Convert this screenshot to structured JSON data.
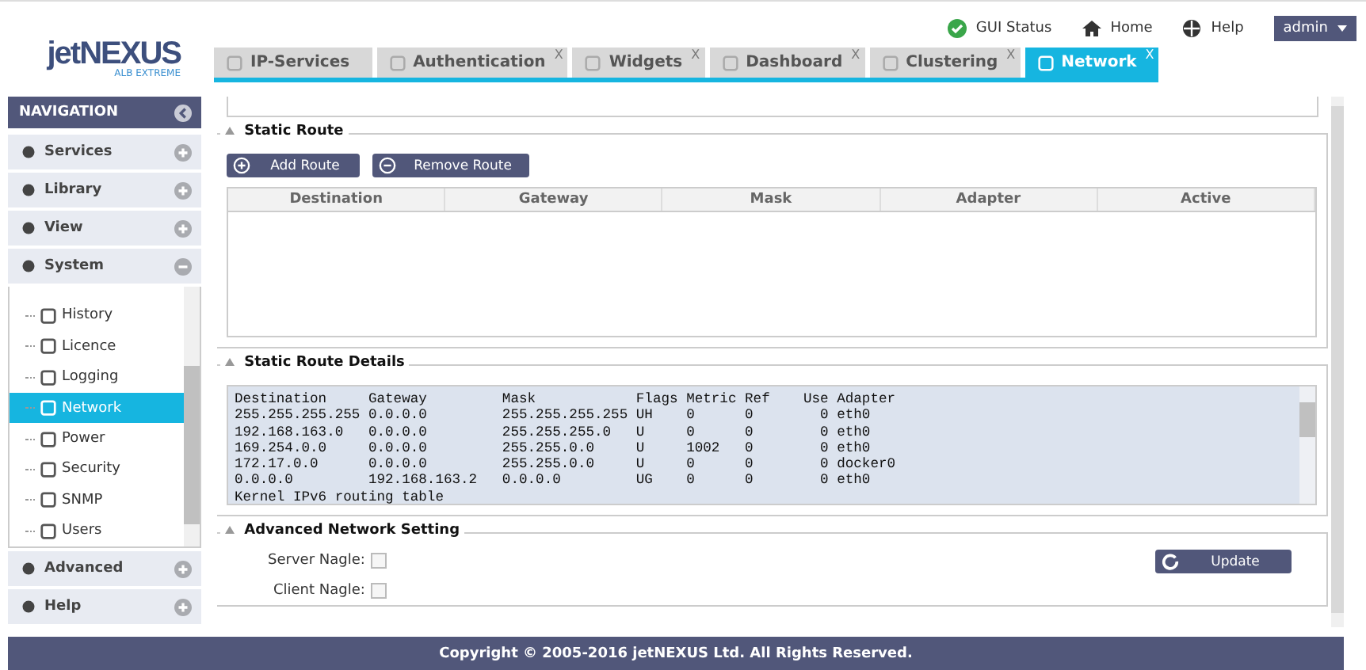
{
  "header": {
    "logo": {
      "name": "jetNEXUS",
      "tagline": "ALB EXTREME"
    },
    "links": [
      {
        "label": "GUI Status"
      },
      {
        "label": "Home"
      },
      {
        "label": "Help"
      }
    ],
    "user_menu": "admin"
  },
  "tabs": [
    {
      "label": "IP-Services",
      "selected": false
    },
    {
      "label": "Authentication",
      "close": "X",
      "selected": false
    },
    {
      "label": "Widgets",
      "close": "X",
      "selected": false
    },
    {
      "label": "Dashboard",
      "close": "X",
      "selected": false
    },
    {
      "label": "Clustering",
      "close": "X",
      "selected": false
    },
    {
      "label": "Network",
      "close": "X",
      "selected": true
    }
  ],
  "sidebar": {
    "title": "NAVIGATION",
    "items": [
      {
        "label": "Services",
        "expanded": false
      },
      {
        "label": "Library",
        "expanded": false
      },
      {
        "label": "View",
        "expanded": false
      },
      {
        "label": "System",
        "expanded": true,
        "children": [
          {
            "label": "History",
            "selected": false
          },
          {
            "label": "Licence",
            "selected": false
          },
          {
            "label": "Logging",
            "selected": false
          },
          {
            "label": "Network",
            "selected": true
          },
          {
            "label": "Power",
            "selected": false
          },
          {
            "label": "Security",
            "selected": false
          },
          {
            "label": "SNMP",
            "selected": false
          },
          {
            "label": "Users",
            "selected": false
          }
        ]
      },
      {
        "label": "Advanced",
        "expanded": false
      },
      {
        "label": "Help",
        "expanded": false
      }
    ]
  },
  "static_route": {
    "title": "Static Route",
    "buttons": [
      "Add Route",
      "Remove Route"
    ],
    "columns": [
      "Destination",
      "Gateway",
      "Mask",
      "Adapter",
      "Active"
    ]
  },
  "static_route_details": {
    "title": "Static Route Details",
    "lines": [
      "Destination     Gateway         Mask            Flags Metric Ref    Use Adapter",
      "255.255.255.255 0.0.0.0         255.255.255.255 UH    0      0        0 eth0",
      "192.168.163.0   0.0.0.0         255.255.255.0   U     0      0        0 eth0",
      "169.254.0.0     0.0.0.0         255.255.0.0     U     1002   0        0 eth0",
      "172.17.0.0      0.0.0.0         255.255.0.0     U     0      0        0 docker0",
      "0.0.0.0         192.168.163.2   0.0.0.0         UG    0      0        0 eth0",
      "Kernel IPv6 routing table"
    ]
  },
  "advanced_network_setting": {
    "title": "Advanced Network Setting",
    "options": [
      {
        "label": "Server Nagle:",
        "checked": false
      },
      {
        "label": "Client Nagle:",
        "checked": false
      }
    ],
    "button": "Update"
  },
  "footer": "Copyright © 2005-2016 jetNEXUS Ltd. All Rights Reserved."
}
